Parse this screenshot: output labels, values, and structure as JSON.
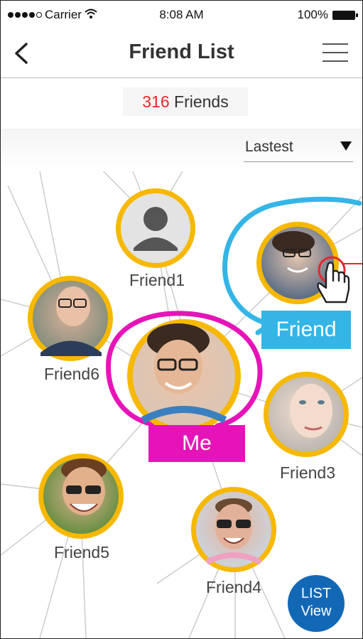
{
  "status_bar": {
    "carrier": "Carrier",
    "time": "8:08 AM",
    "battery": "100%"
  },
  "header": {
    "title": "Friend List"
  },
  "friend_count": {
    "number": "316",
    "label": "Friends"
  },
  "sort": {
    "selected": "Lastest"
  },
  "me_label": "Me",
  "friend_tag": "Friend",
  "friends": [
    {
      "name": "Friend1"
    },
    {
      "name": "Friend6"
    },
    {
      "name": "Friend3"
    },
    {
      "name": "Friend5"
    },
    {
      "name": "Friend4"
    }
  ],
  "list_view_button": {
    "line1": "LIST",
    "line2": "View"
  },
  "colors": {
    "ring": "#f7b800",
    "me": "#e614b8",
    "friend": "#35b4e6",
    "count": "#e8262c",
    "list_button": "#1368b6"
  }
}
